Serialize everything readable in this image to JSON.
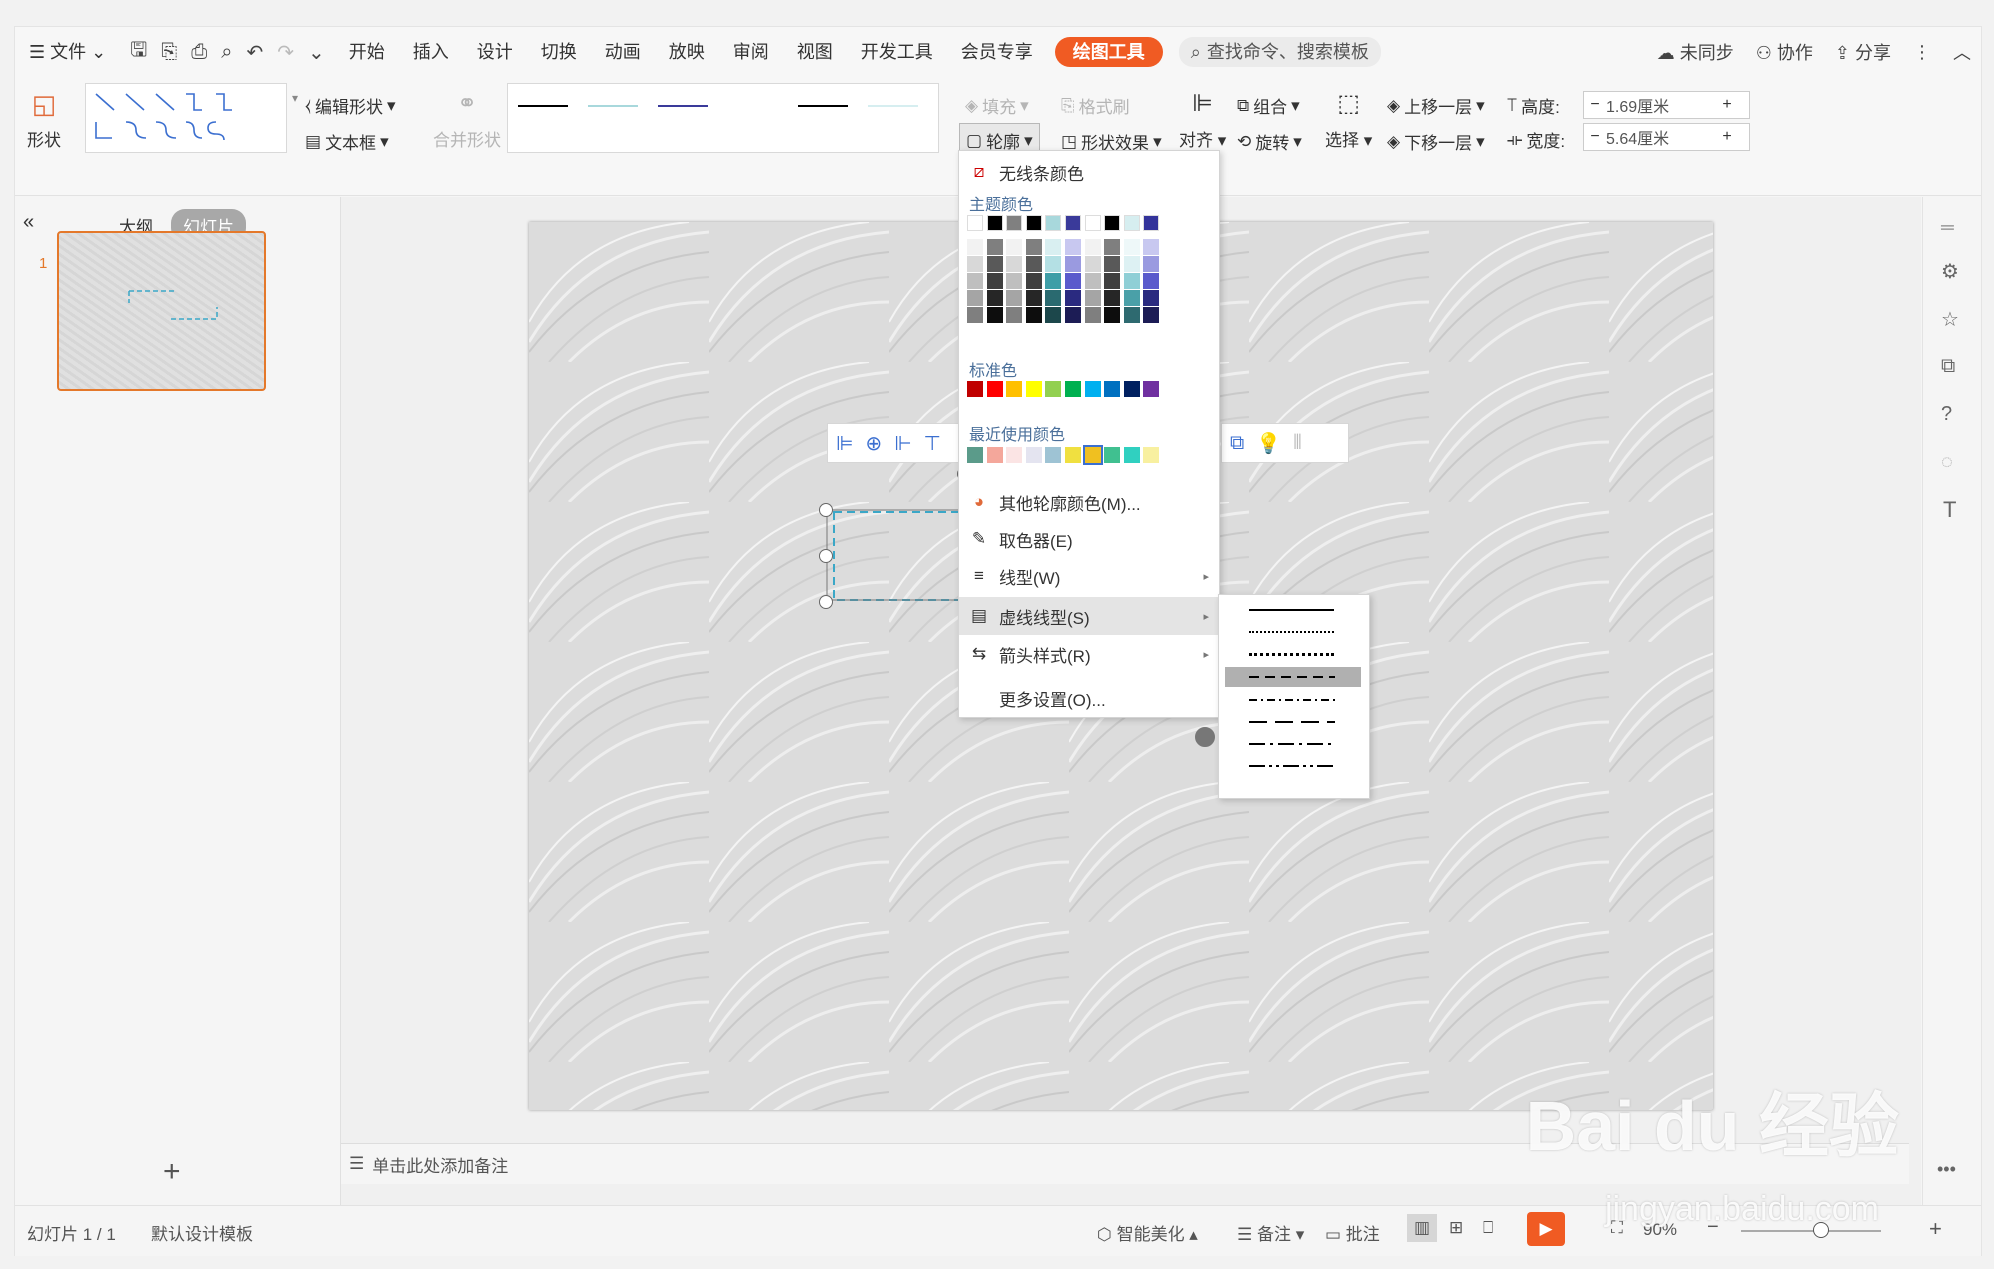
{
  "menubar": {
    "file": "文件",
    "tabs": [
      "开始",
      "插入",
      "设计",
      "切换",
      "动画",
      "放映",
      "审阅",
      "视图",
      "开发工具",
      "会员专享"
    ],
    "draw_tool": "绘图工具",
    "search": "查找命令、搜索模板",
    "unsync": "未同步",
    "collab": "协作",
    "share": "分享"
  },
  "ribbon": {
    "shape": "形状",
    "edit_shape": "编辑形状",
    "textbox": "文本框",
    "merge_shape": "合并形状",
    "fill": "填充",
    "format_painter": "格式刷",
    "outline": "轮廓",
    "shape_effect": "形状效果",
    "align": "对齐",
    "group": "组合",
    "rotate": "旋转",
    "select": "选择",
    "bring_forward": "上移一层",
    "send_backward": "下移一层",
    "height_label": "高度:",
    "height_value": "1.69厘米",
    "width_label": "宽度:",
    "width_value": "5.64厘米"
  },
  "left_panel": {
    "tab_outline": "大纲",
    "tab_slides": "幻灯片",
    "slide_number": "1",
    "add": "+"
  },
  "notes_placeholder": "单击此处添加备注",
  "status": {
    "slide_info": "幻灯片 1 / 1",
    "template": "默认设计模板",
    "smart_beautify": "智能美化",
    "notes": "备注",
    "comments": "批注",
    "zoom": "90%"
  },
  "dropdown": {
    "no_line": "无线条颜色",
    "theme_colors": "主题颜色",
    "standard_colors": "标准色",
    "recent_colors": "最近使用颜色",
    "more_colors": "其他轮廓颜色(M)...",
    "eyedropper": "取色器(E)",
    "line_style": "线型(W)",
    "dash_style": "虚线线型(S)",
    "arrow_style": "箭头样式(R)",
    "more_settings": "更多设置(O)..."
  },
  "colors": {
    "theme_top": [
      "#ffffff",
      "#000000",
      "#808080",
      "#000000",
      "#a8d8dc",
      "#3a3a9a",
      "#ffffff",
      "#000000",
      "#d6eef0",
      "#33339a"
    ],
    "standard": [
      "#c00000",
      "#ff0000",
      "#ffc000",
      "#ffff00",
      "#92d050",
      "#00b050",
      "#00b0f0",
      "#0070c0",
      "#002060",
      "#7030a0"
    ],
    "recent": [
      "#5b9b8a",
      "#f4a79b",
      "#fbe4e4",
      "#e4e4f0",
      "#9ec3d4",
      "#f0e040",
      "#f0c020",
      "#40c090",
      "#30d0c0",
      "#f8f0a0"
    ],
    "accent": "#f05b23"
  },
  "watermark": {
    "brand": "Bai du 经验",
    "url": "jingyan.baidu.com"
  }
}
